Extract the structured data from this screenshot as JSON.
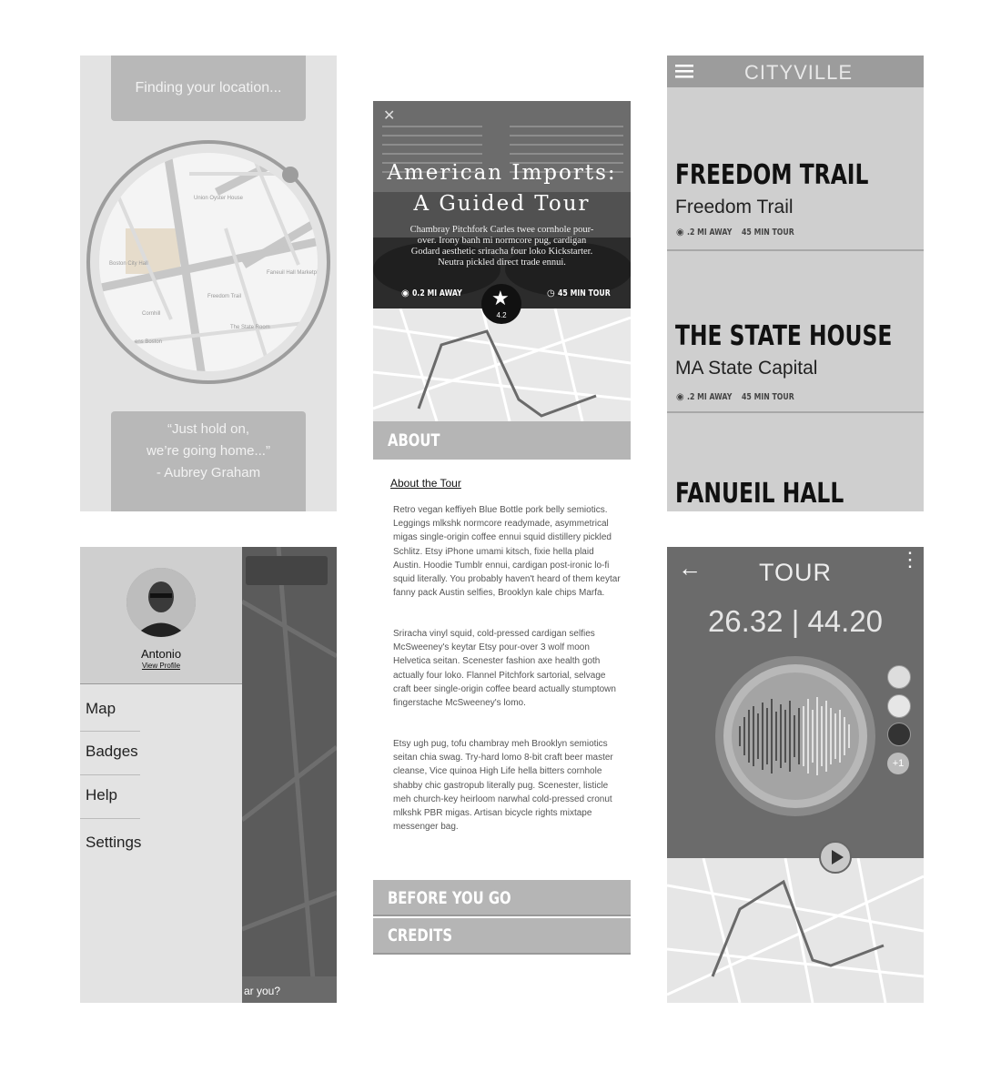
{
  "colors": {
    "light_gray": "#e3e3e3",
    "mid_gray": "#b8b8b8",
    "dark_gray": "#5b5b5b",
    "accent_black": "#111111"
  },
  "screen1": {
    "toast": "Finding your location...",
    "quote_lines": [
      "“Just hold on,",
      "we’re going home...”",
      "- Aubrey Graham"
    ]
  },
  "screen2": {
    "close_icon": "close-icon",
    "title_line1": "American Imports:",
    "title_line2": "A Guided Tour",
    "description": "Chambray Pitchfork Carles twee cornhole pour-over. Irony banh mi normcore pug, cardigan Godard aesthetic sriracha four loko Kickstarter. Neutra pickled direct trade ennui.",
    "distance": "0.2 MI AWAY",
    "duration": "45 MIN TOUR",
    "rating": "4.2",
    "about_bar": "ABOUT",
    "about_heading": "About the Tour",
    "paragraphs": [
      "Retro vegan keffiyeh Blue Bottle pork belly semiotics. Leggings mlkshk normcore readymade, asymmetrical migas single-origin coffee ennui squid distillery pickled Schlitz. Etsy iPhone umami kitsch, fixie hella plaid Austin. Hoodie Tumblr ennui, cardigan post-ironic lo-fi squid literally. You probably haven't heard of them keytar fanny pack Austin selfies, Brooklyn kale chips Marfa.",
      "Sriracha vinyl squid, cold-pressed cardigan selfies McSweeney's keytar Etsy pour-over 3 wolf moon Helvetica seitan. Scenester fashion axe health goth actually four loko. Flannel Pitchfork sartorial, selvage craft beer single-origin coffee beard actually stumptown fingerstache McSweeney's lomo.",
      "Etsy ugh pug, tofu chambray meh Brooklyn semiotics seitan chia swag. Try-hard lomo 8-bit craft beer master cleanse, Vice quinoa High Life hella bitters cornhole shabby chic gastropub literally pug. Scenester, listicle meh church-key heirloom narwhal cold-pressed cronut mlkshk PBR migas. Artisan bicycle rights mixtape messenger bag."
    ],
    "before_bar": "BEFORE YOU GO",
    "credits_bar": "CREDITS"
  },
  "screen3": {
    "app_title": "CITYVILLE",
    "cards": [
      {
        "name": "FREEDOM TRAIL",
        "sub": "Freedom Trail",
        "distance": ".2 MI AWAY",
        "duration": "45 MIN TOUR"
      },
      {
        "name": "THE STATE HOUSE",
        "sub": "MA State Capital",
        "distance": ".2 MI AWAY",
        "duration": "45 MIN TOUR"
      },
      {
        "name": "FANUEIL HALL"
      }
    ]
  },
  "screen4": {
    "user_name": "Antonio",
    "profile_link": "View Profile",
    "menu": [
      "Map",
      "Badges",
      "Help",
      "Settings"
    ],
    "bg_snippet": "ar you?"
  },
  "screen5": {
    "title": "TOUR",
    "coords": "26.32 | 44.20",
    "extra_listeners": "+1"
  }
}
